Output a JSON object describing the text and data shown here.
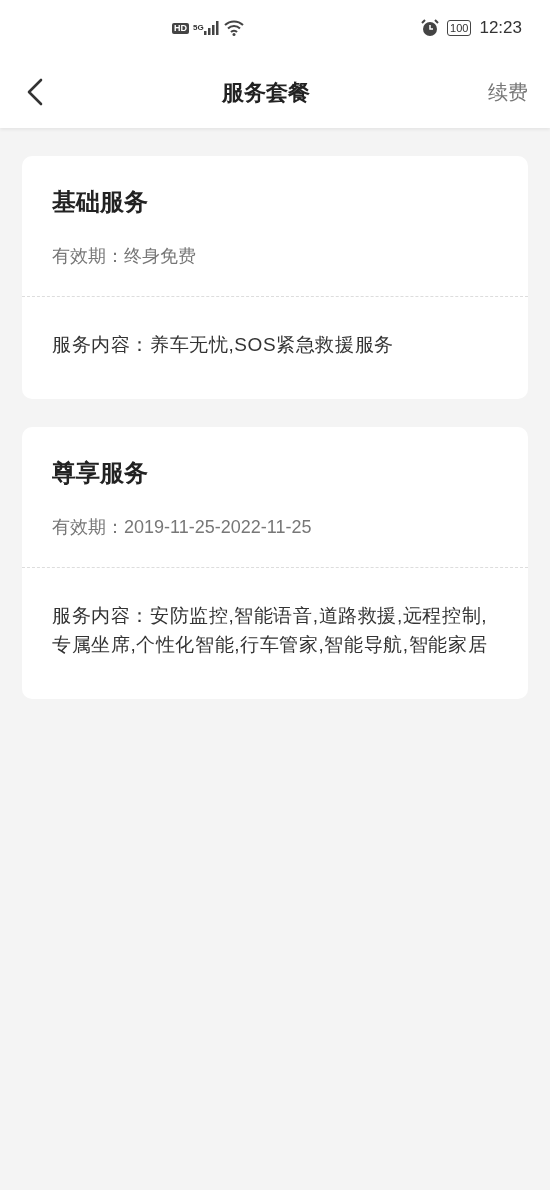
{
  "status_bar": {
    "network_badges": [
      "HD",
      "5G"
    ],
    "battery": "100",
    "time": "12:23"
  },
  "header": {
    "title": "服务套餐",
    "action": "续费"
  },
  "packages": [
    {
      "name": "基础服务",
      "validity": "有效期：终身免费",
      "content": "服务内容：养车无忧,SOS紧急救援服务"
    },
    {
      "name": "尊享服务",
      "validity": "有效期：2019-11-25-2022-11-25",
      "content": "服务内容：安防监控,智能语音,道路救援,远程控制,专属坐席,个性化智能,行车管家,智能导航,智能家居"
    }
  ]
}
